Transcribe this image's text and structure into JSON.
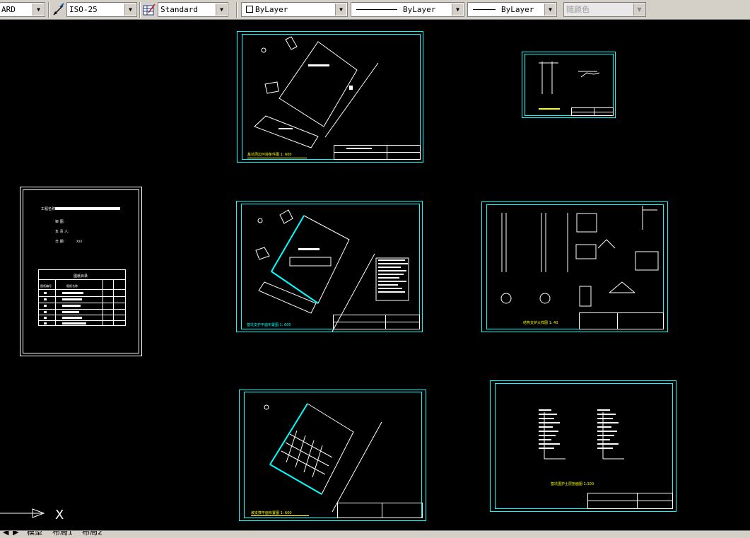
{
  "toolbar": {
    "text_style": "ARD",
    "dim_style": "ISO-25",
    "table_style": "Standard",
    "layer_color": "ByLayer",
    "linetype": "ByLayer",
    "lineweight": "ByLayer",
    "plot_style": "随颜色"
  },
  "sheets": {
    "cover": {
      "project_label": "工程名称:",
      "fields": [
        "审    图:",
        "负 责 人:",
        "日    期:"
      ],
      "date_value": "XXX",
      "index_title": "图纸目录",
      "index_headers": [
        "图纸编号",
        "图纸名称"
      ]
    },
    "site_plan_title": "基坑周边环境条件图  1: 600",
    "support_plan_title": "基坑支护平面布置图  1: 600",
    "soil_nail_title": "坡支撑平面布置图  1: 600",
    "detail_title": "结构支护大样图  1: 40",
    "section_title": "基坑围护土层剖面图  1:100"
  },
  "model_space": {
    "ucs_x": "X"
  },
  "tabs": [
    "模型",
    "布局1",
    "布局2"
  ],
  "colors": {
    "background": "#000000",
    "frame": "#00ffff",
    "linework": "#ffffff",
    "title_underline": "#ffff00"
  }
}
